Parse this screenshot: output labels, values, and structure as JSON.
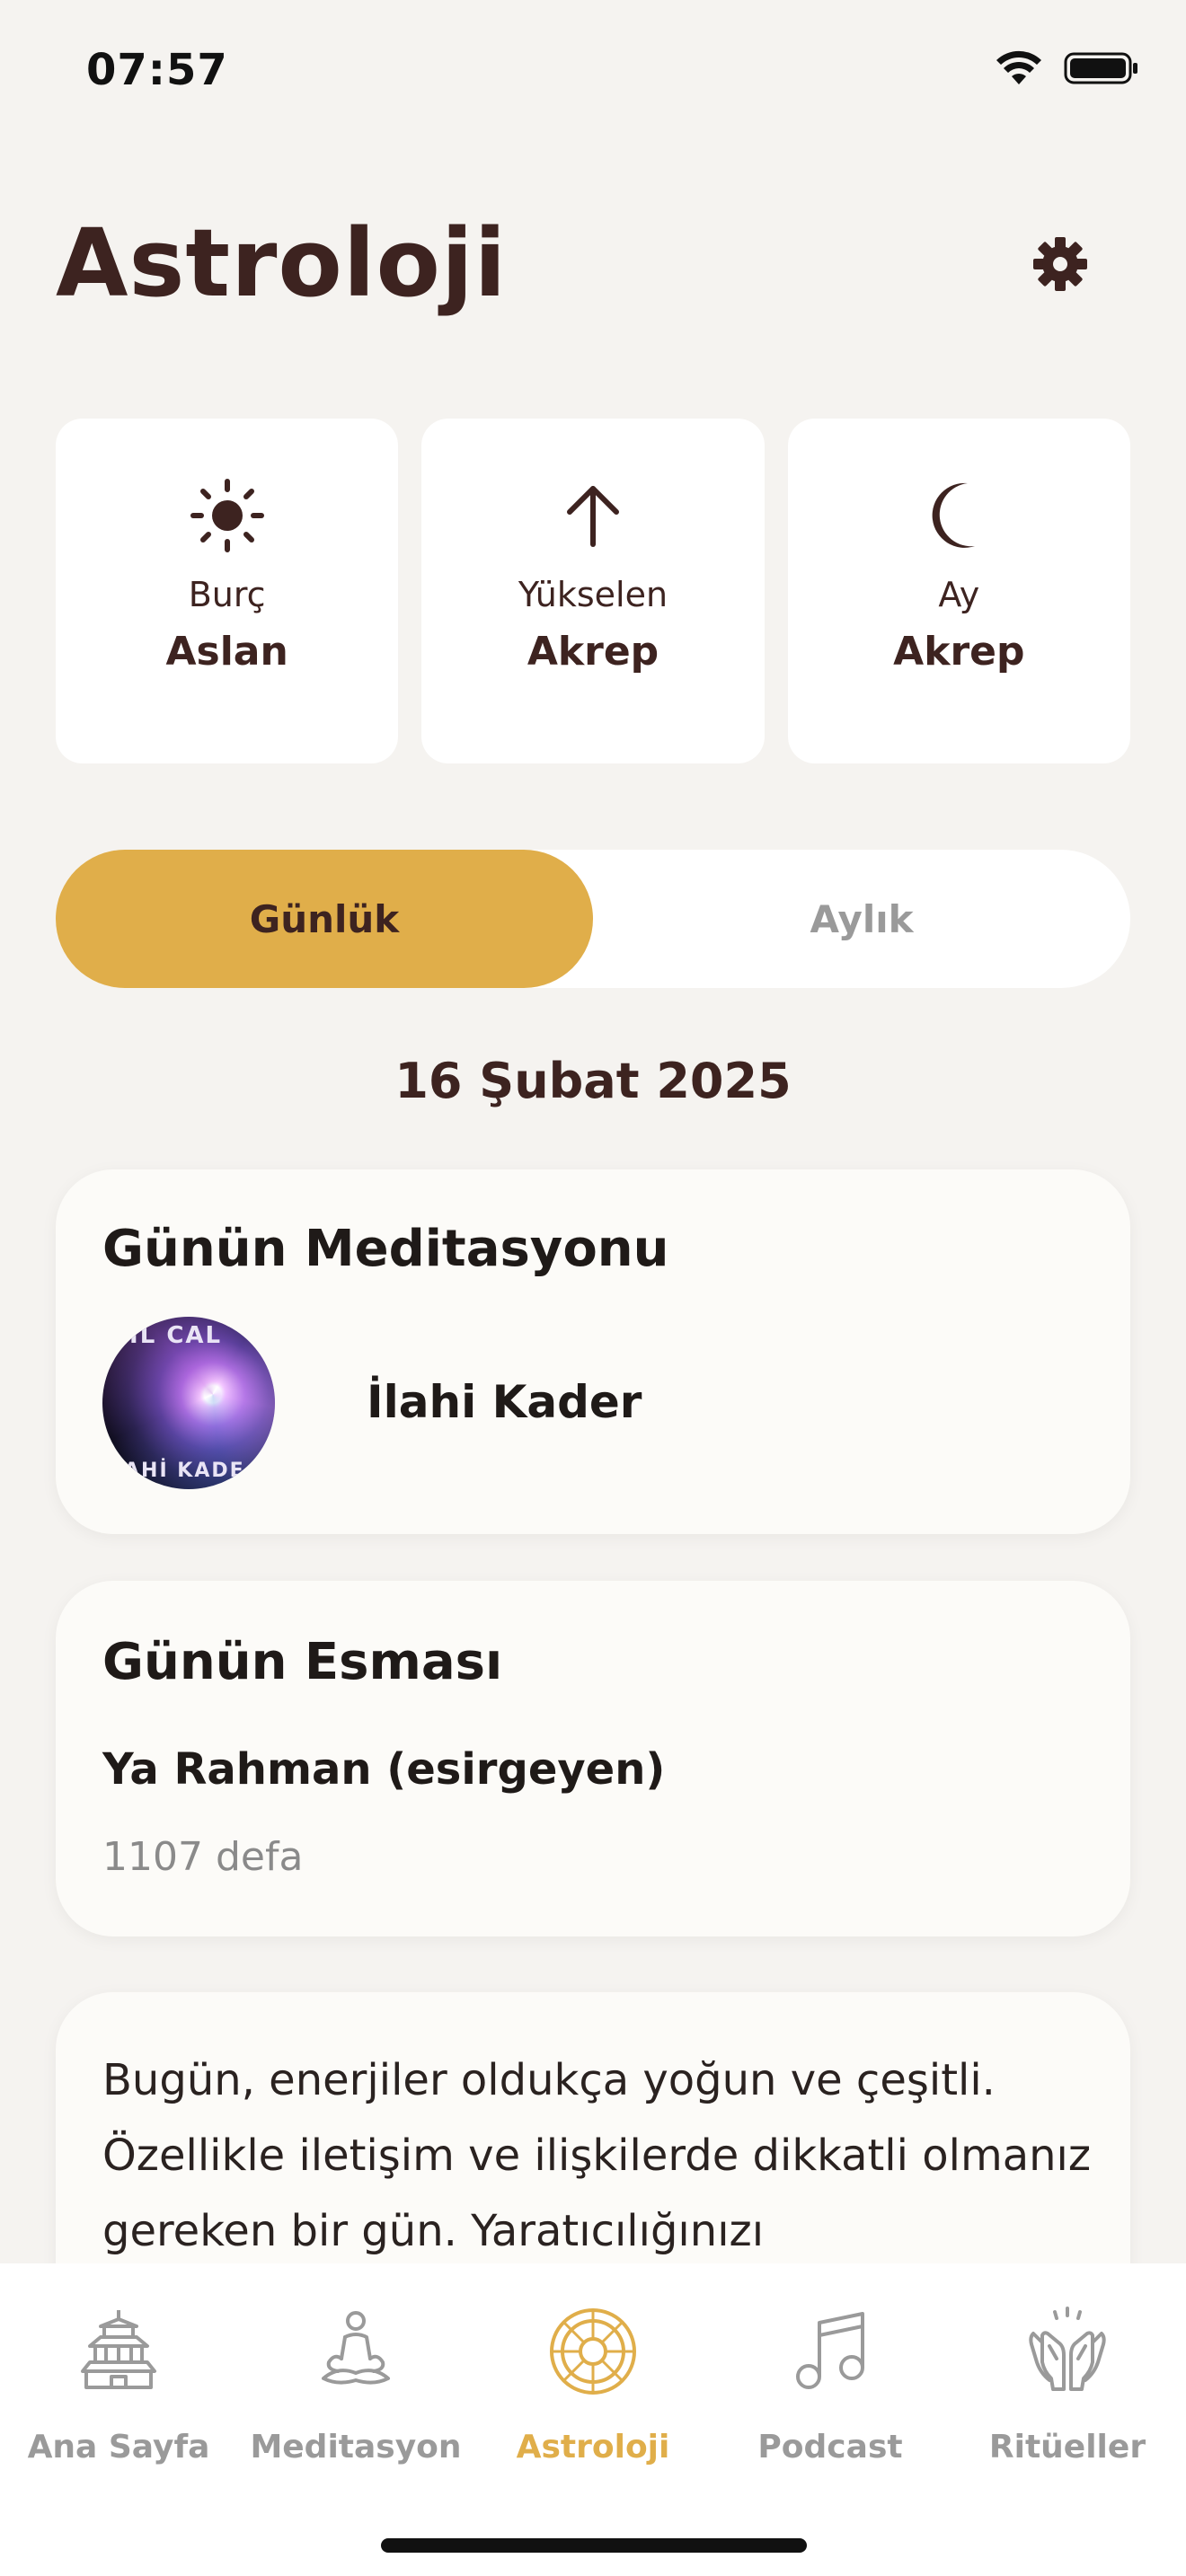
{
  "status_bar": {
    "time": "07:57"
  },
  "header": {
    "title": "Astroloji"
  },
  "signs": [
    {
      "label": "Burç",
      "value": "Aslan",
      "icon": "sun-icon"
    },
    {
      "label": "Yükselen",
      "value": "Akrep",
      "icon": "arrow-up-icon"
    },
    {
      "label": "Ay",
      "value": "Akrep",
      "icon": "moon-icon"
    }
  ],
  "tabs": {
    "daily": "Günlük",
    "monthly": "Aylık",
    "selected": "Günlük"
  },
  "date": "16 Şubat 2025",
  "meditation": {
    "title": "Günün Meditasyonu",
    "name": "İlahi Kader",
    "cover_text_top": "RIL CAL",
    "cover_text_bottom": "LAHİ KADE"
  },
  "esma": {
    "title": "Günün Esması",
    "name": "Ya Rahman (esirgeyen)",
    "count": "1107 defa"
  },
  "horoscope": {
    "text": "Bugün, enerjiler oldukça yoğun ve çeşitli. Özellikle iletişim ve ilişkilerde dikkatli olmanız gereken bir gün. Yaratıcılığınızı"
  },
  "nav": {
    "items": [
      {
        "label": "Ana Sayfa",
        "icon": "temple-icon"
      },
      {
        "label": "Meditasyon",
        "icon": "meditation-icon"
      },
      {
        "label": "Astroloji",
        "icon": "zodiac-wheel-icon"
      },
      {
        "label": "Podcast",
        "icon": "music-note-icon"
      },
      {
        "label": "Ritüeller",
        "icon": "praying-hands-icon"
      }
    ],
    "active": "Astroloji"
  },
  "colors": {
    "accent": "#e0ae4a",
    "primary_text": "#3d2320",
    "background": "#f5f3f0",
    "inactive": "#9a9a9a"
  }
}
